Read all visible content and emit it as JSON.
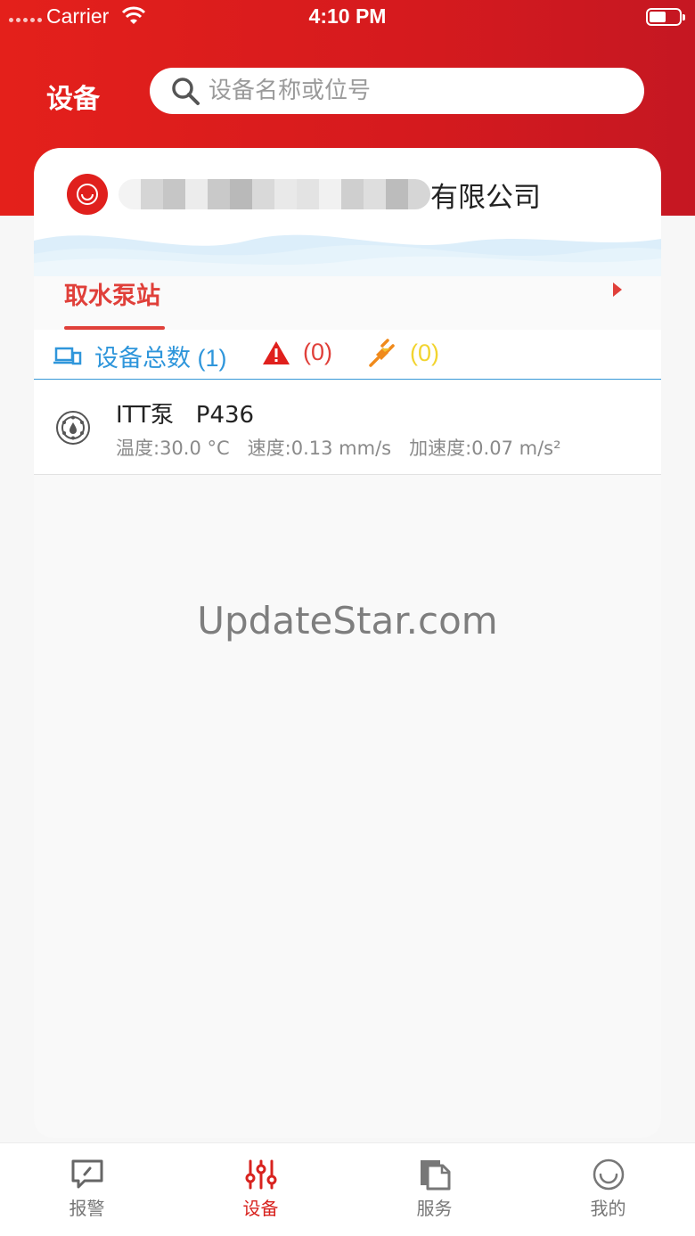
{
  "status_bar": {
    "carrier": "Carrier",
    "time": "4:10 PM"
  },
  "header": {
    "title": "设备",
    "search_placeholder": "设备名称或位号"
  },
  "company": {
    "name_visible_suffix": "有限公司"
  },
  "tab": {
    "label": "取水泵站"
  },
  "counts": {
    "total_label": "设备总数 (1)",
    "alarm_label": "(0)",
    "offline_label": "(0)"
  },
  "devices": [
    {
      "name": "ITT泵   P436",
      "temperature": "温度:30.0 °C",
      "speed": "速度:0.13 mm/s",
      "acceleration": "加速度:0.07 m/s²"
    }
  ],
  "watermark": "UpdateStar.com",
  "tabbar": [
    {
      "label": "报警",
      "icon": "alarm-note-icon"
    },
    {
      "label": "设备",
      "icon": "equalizer-icon",
      "active": true
    },
    {
      "label": "服务",
      "icon": "document-icon"
    },
    {
      "label": "我的",
      "icon": "smile-icon"
    }
  ],
  "colors": {
    "brand_red": "#e0201d",
    "accent_blue": "#2f96db",
    "alarm_red": "#e0403a",
    "offline_yellow": "#f2d430"
  }
}
